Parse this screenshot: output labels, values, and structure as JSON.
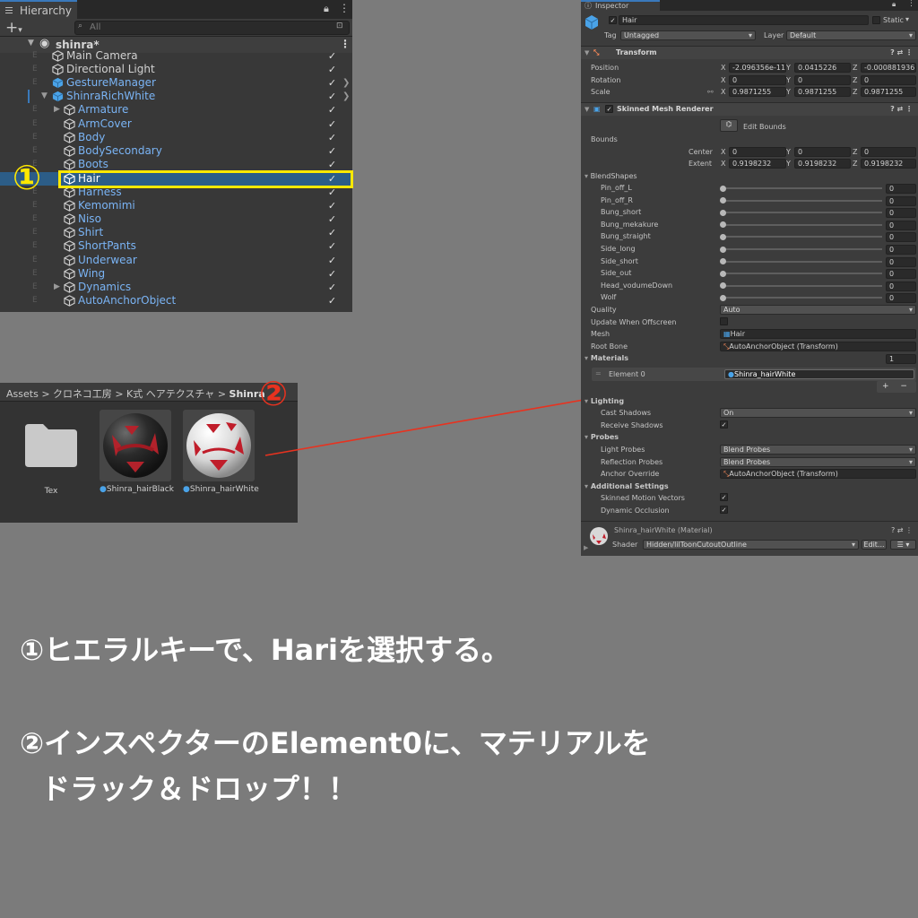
{
  "hierarchy": {
    "tab_title": "Hierarchy",
    "search_placeholder": "All",
    "scene_name": "shinra*",
    "items": [
      {
        "label": "Main Camera"
      },
      {
        "label": "Directional Light"
      },
      {
        "label": "GestureManager"
      },
      {
        "label": "ShinraRichWhite"
      },
      {
        "label": "Armature"
      },
      {
        "label": "ArmCover"
      },
      {
        "label": "Body"
      },
      {
        "label": "BodySecondary"
      },
      {
        "label": "Boots"
      },
      {
        "label": "Hair"
      },
      {
        "label": "Harness"
      },
      {
        "label": "Kemomimi"
      },
      {
        "label": "Niso"
      },
      {
        "label": "Shirt"
      },
      {
        "label": "ShortPants"
      },
      {
        "label": "Underwear"
      },
      {
        "label": "Wing"
      },
      {
        "label": "Dynamics"
      },
      {
        "label": "AutoAnchorObject"
      }
    ],
    "check_mark": "✓",
    "annotation": "①"
  },
  "assets": {
    "breadcrumb": [
      "Assets",
      "クロネコ工房",
      "K式 ヘアテクスチャ",
      "Shinra"
    ],
    "separator": ">",
    "items": [
      {
        "label": "Tex",
        "kind": "folder"
      },
      {
        "label": "Shinra_hairBlack",
        "kind": "material"
      },
      {
        "label": "Shinra_hairWhite",
        "kind": "material"
      }
    ],
    "annotation": "②",
    "arrow_color": "#e8321f"
  },
  "inspector": {
    "tab_title": "Inspector",
    "object_name": "Hair",
    "static_label": "Static",
    "tag_label": "Tag",
    "tag_value": "Untagged",
    "layer_label": "Layer",
    "layer_value": "Default",
    "transform": {
      "title": "Transform",
      "position_label": "Position",
      "rotation_label": "Rotation",
      "scale_label": "Scale",
      "position": [
        "-2.096356e-11",
        "0.0415226",
        "-0.000881936"
      ],
      "rotation": [
        "0",
        "0",
        "0"
      ],
      "scale": [
        "0.9871255",
        "0.9871255",
        "0.9871255"
      ]
    },
    "axis": [
      "X",
      "Y",
      "Z"
    ],
    "smr": {
      "title": "Skinned Mesh Renderer",
      "edit_bounds": "Edit Bounds",
      "bounds_label": "Bounds",
      "center_label": "Center",
      "extent_label": "Extent",
      "center": [
        "0",
        "0",
        "0"
      ],
      "extent": [
        "0.9198232",
        "0.9198232",
        "0.9198232"
      ],
      "blendshapes_label": "BlendShapes",
      "blendshapes": [
        {
          "name": "Pin_off_L",
          "value": "0"
        },
        {
          "name": "Pin_off_R",
          "value": "0"
        },
        {
          "name": "Bung_short",
          "value": "0"
        },
        {
          "name": "Bung_mekakure",
          "value": "0"
        },
        {
          "name": "Bung_straight",
          "value": "0"
        },
        {
          "name": "Side_long",
          "value": "0"
        },
        {
          "name": "Side_short",
          "value": "0"
        },
        {
          "name": "Side_out",
          "value": "0"
        },
        {
          "name": "Head_vodumeDown",
          "value": "0"
        },
        {
          "name": "Wolf",
          "value": "0"
        }
      ],
      "quality_label": "Quality",
      "quality_value": "Auto",
      "update_offscreen_label": "Update When Offscreen",
      "mesh_label": "Mesh",
      "mesh_value": "Hair",
      "root_bone_label": "Root Bone",
      "root_bone_value": "AutoAnchorObject (Transform)",
      "materials_label": "Materials",
      "materials_count": "1",
      "element0_label": "Element 0",
      "element0_value": "Shinra_hairWhite",
      "plus": "+",
      "minus": "−",
      "lighting_label": "Lighting",
      "cast_shadows_label": "Cast Shadows",
      "cast_shadows_value": "On",
      "receive_shadows_label": "Receive Shadows",
      "probes_label": "Probes",
      "light_probes_label": "Light Probes",
      "light_probes_value": "Blend Probes",
      "reflection_probes_label": "Reflection Probes",
      "reflection_probes_value": "Blend Probes",
      "anchor_override_label": "Anchor Override",
      "anchor_override_value": "AutoAnchorObject (Transform)",
      "additional_label": "Additional Settings",
      "motion_vectors_label": "Skinned Motion Vectors",
      "dynamic_occlusion_label": "Dynamic Occlusion"
    },
    "material": {
      "title": "Shinra_hairWhite (Material)",
      "shader_label": "Shader",
      "shader_value": "Hidden/lilToonCutoutOutline",
      "edit_label": "Edit..."
    }
  },
  "instructions": {
    "line1": "①ヒエラルキーで、Hariを選択する。",
    "line2": "②インスペクターのElement0に、マテリアルを",
    "line3": "ドラック＆ドロップ！！"
  },
  "colors": {
    "background": "#7b7b7b",
    "highlight_yellow": "#ffe800",
    "annotation_red": "#e8321f",
    "selection_blue": "#2c5d87",
    "prefab_blue": "#7ab4f5"
  }
}
